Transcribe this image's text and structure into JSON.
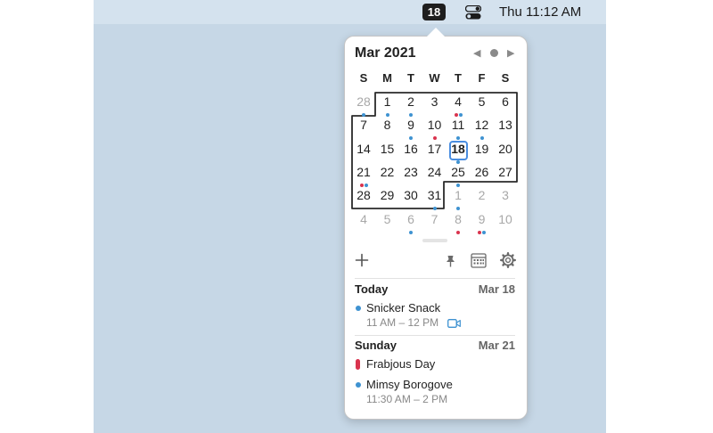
{
  "menubar": {
    "date_badge": "18",
    "clock": "Thu 11:12 AM"
  },
  "calendar": {
    "month_title": "Mar 2021",
    "weekdays": [
      "S",
      "M",
      "T",
      "W",
      "T",
      "F",
      "S"
    ],
    "weeks": [
      [
        "28",
        "1",
        "2",
        "3",
        "4",
        "5",
        "6"
      ],
      [
        "7",
        "8",
        "9",
        "10",
        "11",
        "12",
        "13"
      ],
      [
        "14",
        "15",
        "16",
        "17",
        "18",
        "19",
        "20"
      ],
      [
        "21",
        "22",
        "23",
        "24",
        "25",
        "26",
        "27"
      ],
      [
        "28",
        "29",
        "30",
        "31",
        "1",
        "2",
        "3"
      ],
      [
        "4",
        "5",
        "6",
        "7",
        "8",
        "9",
        "10"
      ]
    ],
    "selected_day": "18"
  },
  "colors": {
    "blue": "#3e92d1",
    "red": "#d9334e",
    "today_ring": "#4a8de0"
  },
  "toolbar": {
    "add_icon": "plus-icon",
    "pin_icon": "pin-icon",
    "calendar_icon": "calendar-icon",
    "settings_icon": "gear-icon"
  },
  "agenda": {
    "sections": [
      {
        "title": "Today",
        "date": "Mar 18",
        "events": [
          {
            "title": "Snicker Snack",
            "time": "11 AM – 12 PM",
            "has_video": true
          }
        ]
      },
      {
        "title": "Sunday",
        "date": "Mar 21",
        "events": [
          {
            "title": "Frabjous Day",
            "all_day": true
          },
          {
            "title": "Mimsy Borogove",
            "time": "11:30 AM – 2 PM"
          }
        ]
      }
    ]
  }
}
